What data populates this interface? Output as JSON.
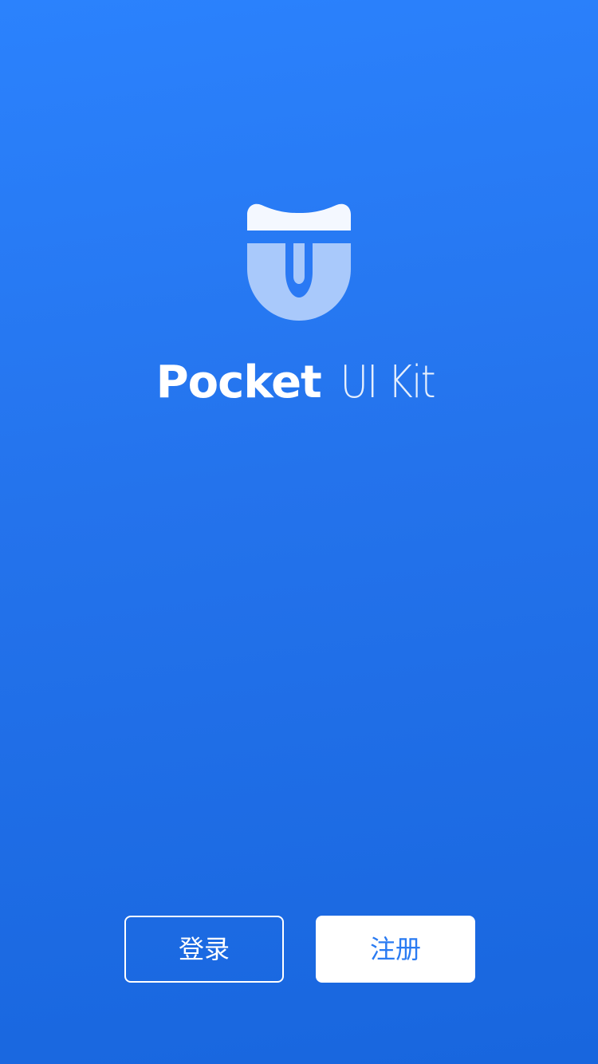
{
  "brand": {
    "name_bold": "Pocket",
    "name_light": "UI Kit"
  },
  "actions": {
    "login_label": "登录",
    "register_label": "注册"
  },
  "colors": {
    "background_top": "#2b82fd",
    "background_bottom": "#1866de",
    "button_text_blue": "#2a7bf2",
    "logo_cap": "#f4f8ff",
    "logo_body": "#a9c9fb"
  },
  "icons": {
    "logo": "pocket-u-logo-icon"
  }
}
